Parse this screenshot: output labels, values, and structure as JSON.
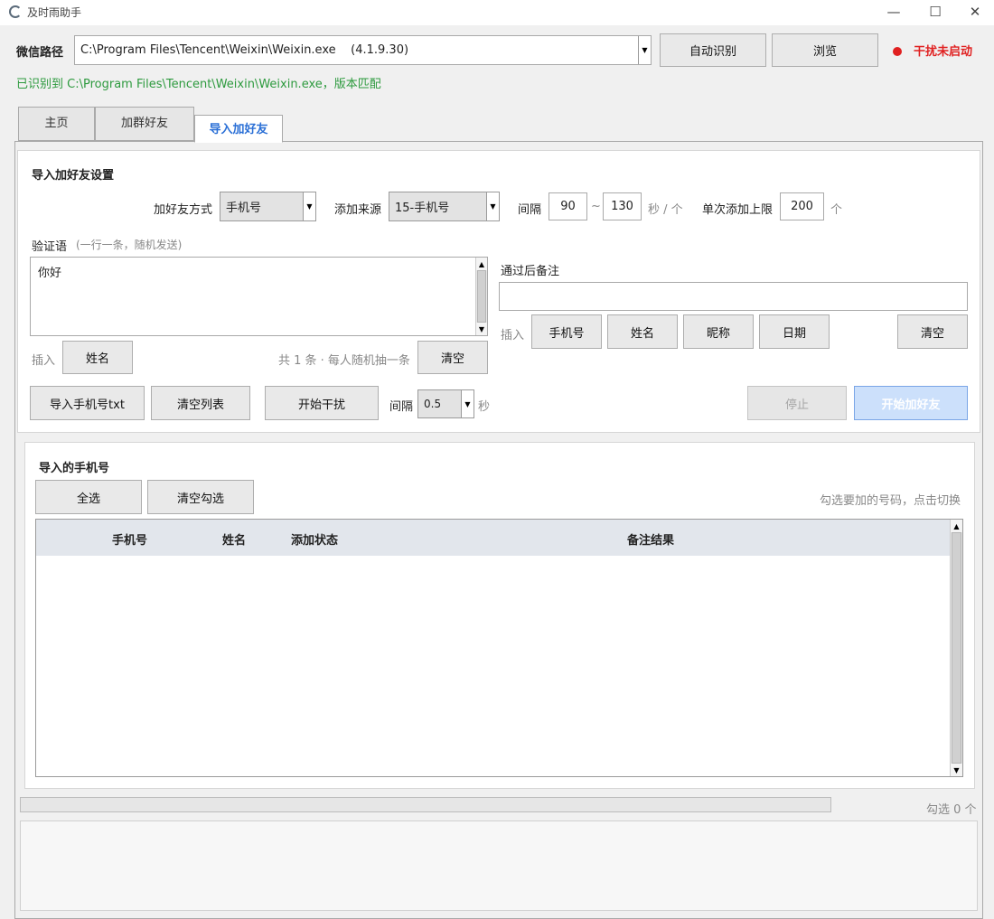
{
  "window": {
    "title": "及时雨助手",
    "minimize": "—",
    "maximize": "☐",
    "close": "✕"
  },
  "top": {
    "path_label": "微信路径",
    "path_value": "C:\\Program Files\\Tencent\\Weixin\\Weixin.exe    (4.1.9.30)",
    "auto_detect": "自动识别",
    "browse": "浏览",
    "status_text": "干扰未启动",
    "status_color": "#e02020",
    "detected_text": "已识别到 C:\\Program Files\\Tencent\\Weixin\\Weixin.exe，版本匹配"
  },
  "tabs": [
    {
      "label": "主页"
    },
    {
      "label": "加群好友"
    },
    {
      "label": "导入加好友",
      "active": true
    }
  ],
  "settings": {
    "title": "导入加好友设置",
    "method_label": "加好友方式",
    "method_value": "手机号",
    "source_label": "添加来源",
    "source_value": "15-手机号",
    "interval_label": "间隔",
    "interval_min": "90",
    "interval_sep": "~",
    "interval_max": "130",
    "interval_unit": "秒 / 个",
    "limit_label": "单次添加上限",
    "limit_value": "200",
    "limit_unit": "个",
    "verify_label": "验证语",
    "verify_hint": "(一行一条，随机发送)",
    "verify_text": "你好",
    "insert_label": "插入",
    "insert_name": "姓名",
    "verify_count": "共 1 条 · 每人随机抽一条",
    "verify_clear": "清空",
    "remark_label": "通过后备注",
    "remark_value": "",
    "remark_insert_label": "插入",
    "remark_buttons": [
      "手机号",
      "姓名",
      "昵称",
      "日期"
    ],
    "remark_clear": "清空",
    "import_txt": "导入手机号txt",
    "clear_list": "清空列表",
    "start_interfere": "开始干扰",
    "int2_label": "间隔",
    "int2_value": "0.5",
    "int2_unit": "秒",
    "stop": "停止",
    "start_add": "开始加好友"
  },
  "imported": {
    "title": "导入的手机号",
    "select_all": "全选",
    "clear_selection": "清空勾选",
    "hint": "勾选要加的号码，点击切换",
    "columns": [
      "手机号",
      "姓名",
      "添加状态",
      "备注结果"
    ],
    "rows": []
  },
  "footer": {
    "selected_count": "勾选 0 个",
    "progress": 0
  },
  "log": {
    "text": ""
  }
}
